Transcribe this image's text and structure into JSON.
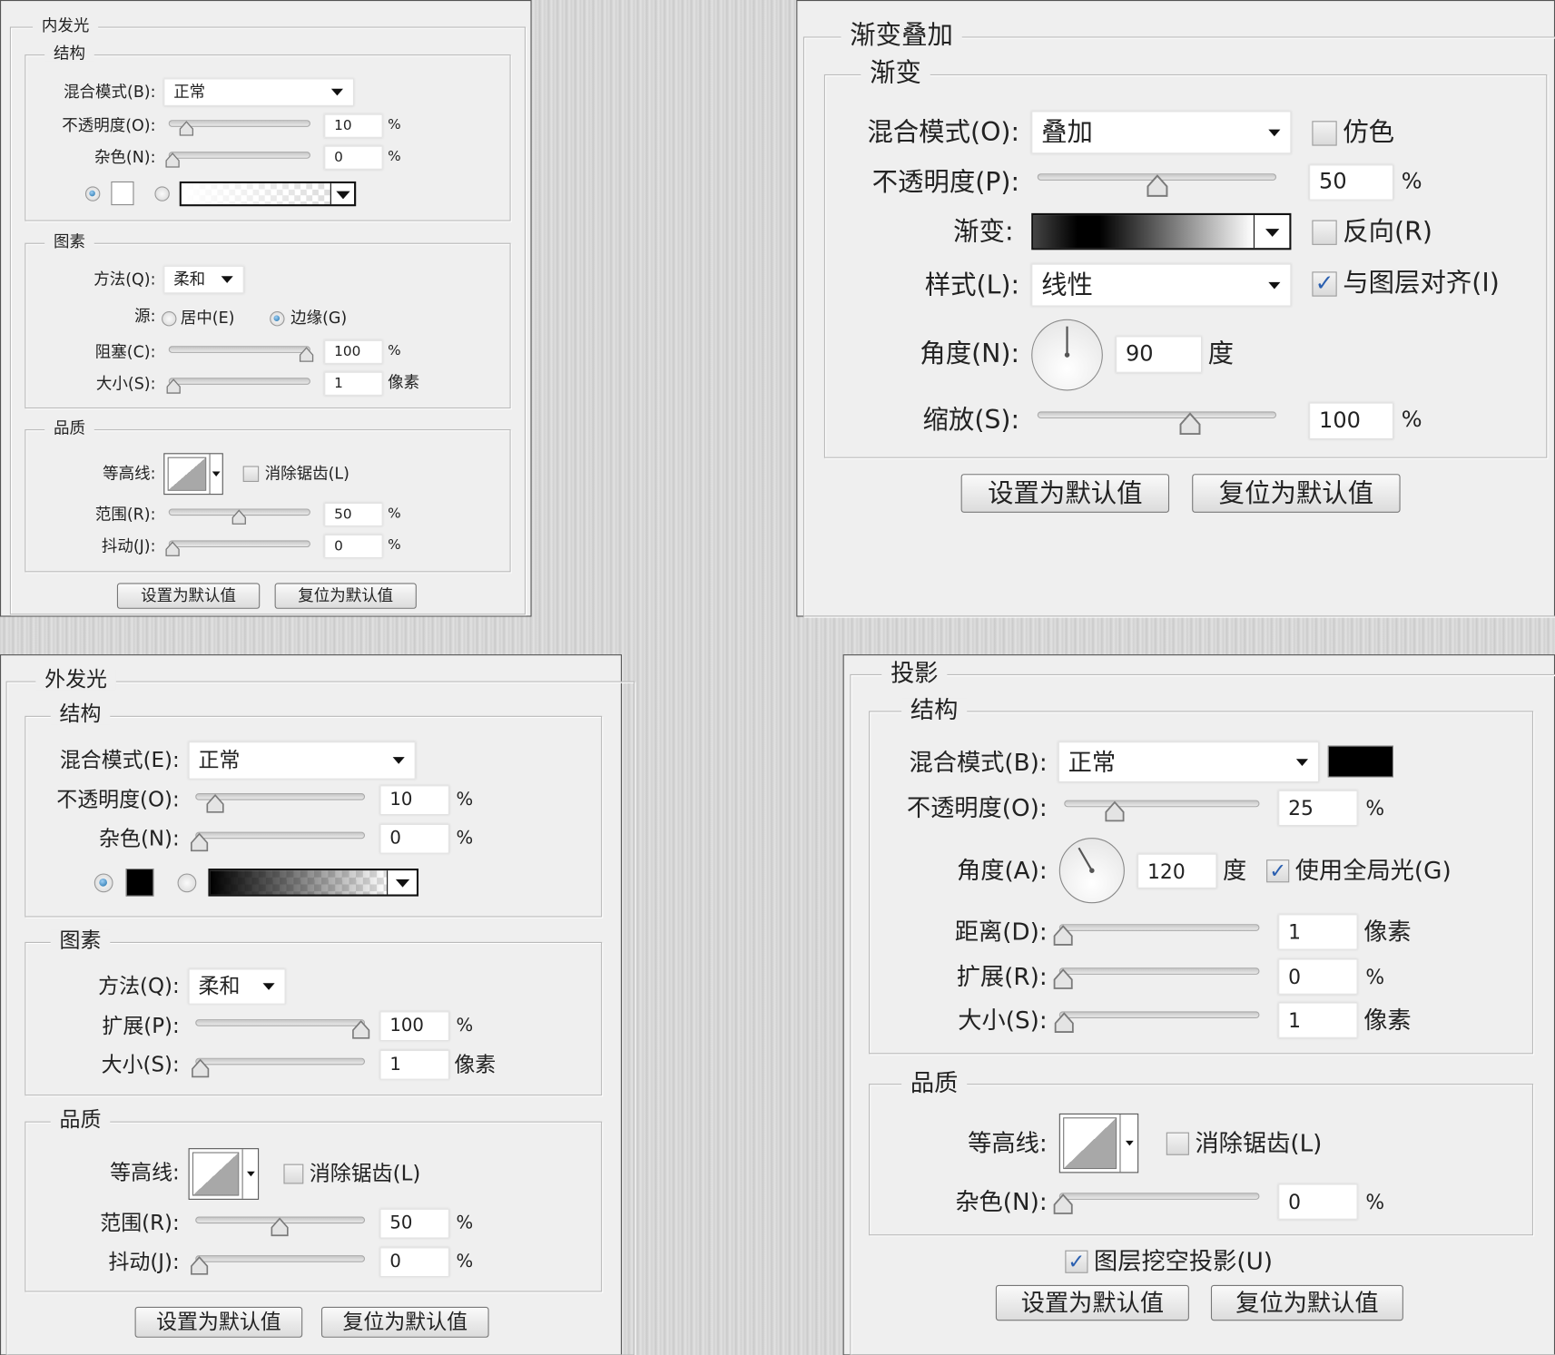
{
  "inner_glow": {
    "title": "内发光",
    "structure": {
      "title": "结构",
      "blend_mode_label": "混合模式(B):",
      "blend_mode": "正常",
      "opacity_label": "不透明度(O):",
      "opacity": "10",
      "noise_label": "杂色(N):",
      "noise": "0",
      "percent": "%",
      "color_mode": "solid",
      "color": "#ffffff"
    },
    "elements": {
      "title": "图素",
      "technique_label": "方法(Q):",
      "technique": "柔和",
      "source_label": "源:",
      "source_center": "居中(E)",
      "source_edge": "边缘(G)",
      "source_selected": "edge",
      "choke_label": "阻塞(C):",
      "choke": "100",
      "size_label": "大小(S):",
      "size": "1",
      "pixels": "像素"
    },
    "quality": {
      "title": "品质",
      "contour_label": "等高线:",
      "antialias_label": "消除锯齿(L)",
      "antialias": false,
      "range_label": "范围(R):",
      "range": "50",
      "jitter_label": "抖动(J):",
      "jitter": "0"
    },
    "buttons": {
      "make_default": "设置为默认值",
      "reset_default": "复位为默认值"
    }
  },
  "gradient_overlay": {
    "title": "渐变叠加",
    "gradient": {
      "title": "渐变",
      "blend_mode_label": "混合模式(O):",
      "blend_mode": "叠加",
      "dither_label": "仿色",
      "dither": false,
      "opacity_label": "不透明度(P):",
      "opacity": "50",
      "percent": "%",
      "gradient_label": "渐变:",
      "reverse_label": "反向(R)",
      "reverse": false,
      "style_label": "样式(L):",
      "style": "线性",
      "align_label": "与图层对齐(I)",
      "align": true,
      "angle_label": "角度(N):",
      "angle": "90",
      "degree": "度",
      "scale_label": "缩放(S):",
      "scale": "100"
    },
    "buttons": {
      "make_default": "设置为默认值",
      "reset_default": "复位为默认值"
    }
  },
  "outer_glow": {
    "title": "外发光",
    "structure": {
      "title": "结构",
      "blend_mode_label": "混合模式(E):",
      "blend_mode": "正常",
      "opacity_label": "不透明度(O):",
      "opacity": "10",
      "noise_label": "杂色(N):",
      "noise": "0",
      "percent": "%",
      "color_mode": "solid",
      "color": "#000000"
    },
    "elements": {
      "title": "图素",
      "technique_label": "方法(Q):",
      "technique": "柔和",
      "spread_label": "扩展(P):",
      "spread": "100",
      "size_label": "大小(S):",
      "size": "1",
      "pixels": "像素"
    },
    "quality": {
      "title": "品质",
      "contour_label": "等高线:",
      "antialias_label": "消除锯齿(L)",
      "antialias": false,
      "range_label": "范围(R):",
      "range": "50",
      "jitter_label": "抖动(J):",
      "jitter": "0"
    },
    "buttons": {
      "make_default": "设置为默认值",
      "reset_default": "复位为默认值"
    }
  },
  "drop_shadow": {
    "title": "投影",
    "structure": {
      "title": "结构",
      "blend_mode_label": "混合模式(B):",
      "blend_mode": "正常",
      "color": "#000000",
      "opacity_label": "不透明度(O):",
      "opacity": "25",
      "percent": "%",
      "angle_label": "角度(A):",
      "angle": "120",
      "degree": "度",
      "global_light_label": "使用全局光(G)",
      "global_light": true,
      "distance_label": "距离(D):",
      "distance": "1",
      "pixels": "像素",
      "spread_label": "扩展(R):",
      "spread": "0",
      "size_label": "大小(S):",
      "size": "1"
    },
    "quality": {
      "title": "品质",
      "contour_label": "等高线:",
      "antialias_label": "消除锯齿(L)",
      "antialias": false,
      "noise_label": "杂色(N):",
      "noise": "0"
    },
    "knockout_label": "图层挖空投影(U)",
    "knockout": true,
    "buttons": {
      "make_default": "设置为默认值",
      "reset_default": "复位为默认值"
    }
  }
}
